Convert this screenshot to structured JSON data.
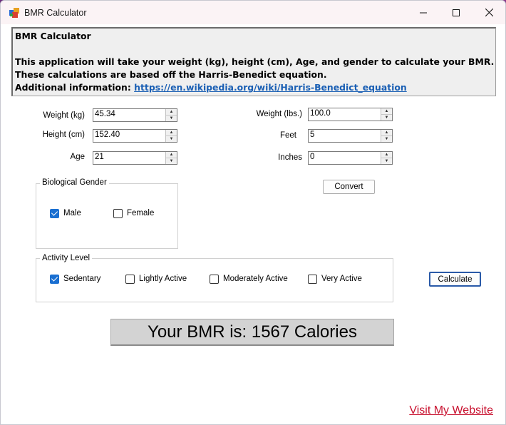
{
  "window": {
    "title": "BMR Calculator"
  },
  "info": {
    "heading": "BMR Calculator",
    "line1": "This application will take your weight (kg), height (cm), Age, and gender to calculate your BMR.",
    "line2": "These calculations are based off the Harris-Benedict equation.",
    "line3_label": "Additional information:",
    "line3_link": "https://en.wikipedia.org/wiki/Harris-Benedict_equation"
  },
  "metric": {
    "weight_label": "Weight (kg)",
    "weight_value": "45.34",
    "height_label": "Height (cm)",
    "height_value": "152.40",
    "age_label": "Age",
    "age_value": "21"
  },
  "imperial": {
    "weight_label": "Weight (lbs.)",
    "weight_value": "100.0",
    "feet_label": "Feet",
    "feet_value": "5",
    "inches_label": "Inches",
    "inches_value": "0"
  },
  "convert_button": "Convert",
  "gender": {
    "title": "Biological Gender",
    "male_label": "Male",
    "male_checked": true,
    "female_label": "Female",
    "female_checked": false
  },
  "activity": {
    "title": "Activity Level",
    "options": [
      {
        "label": "Sedentary",
        "checked": true
      },
      {
        "label": "Lightly Active",
        "checked": false
      },
      {
        "label": "Moderately Active",
        "checked": false
      },
      {
        "label": "Very Active",
        "checked": false
      }
    ]
  },
  "calculate_button": "Calculate",
  "result_text": "Your BMR is: 1567 Calories",
  "website_link": "Visit My Website",
  "colors": {
    "link_blue": "#1a5fb4",
    "website_red": "#c8102e",
    "checkbox_checked": "#1a6fd1"
  }
}
